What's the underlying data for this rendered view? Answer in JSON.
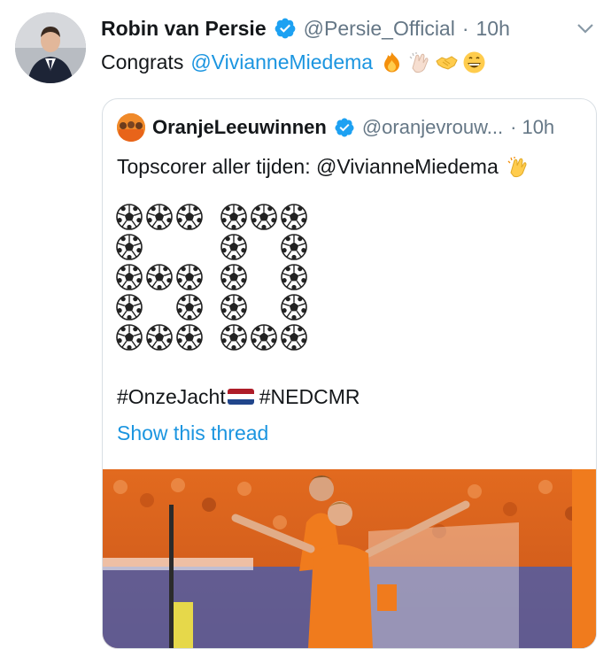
{
  "tweet": {
    "author_name": "Robin van Persie",
    "author_handle": "@Persie_Official",
    "separator": "·",
    "time": "10h",
    "text_prefix": "Congrats",
    "mention": "@VivianneMiedema",
    "emojis": [
      "fire",
      "clapping-hands",
      "handshake",
      "grinning-face"
    ],
    "avatar_icon": "profile-photo",
    "menu_icon": "chevron-down-icon"
  },
  "quoted_tweet": {
    "author_name": "OranjeLeeuwinnen",
    "author_handle": "@oranjevrouw...",
    "separator": "·",
    "time": "10h",
    "text": "Topscorer aller tijden: @VivianneMiedema",
    "text_emoji": "clapping-hands",
    "number_made_of_balls": "60",
    "hashtag_1": "#OnzeJacht",
    "hashtag_flag": "netherlands-flag",
    "hashtag_2": "#NEDCMR",
    "show_thread": "Show this thread",
    "media": "photo of celebrating players in orange"
  },
  "colors": {
    "link": "#1b95e0",
    "secondary_text": "#657786",
    "verified": "#1da1f2",
    "border": "#d9dfe4",
    "orange": "#f07b1d"
  }
}
